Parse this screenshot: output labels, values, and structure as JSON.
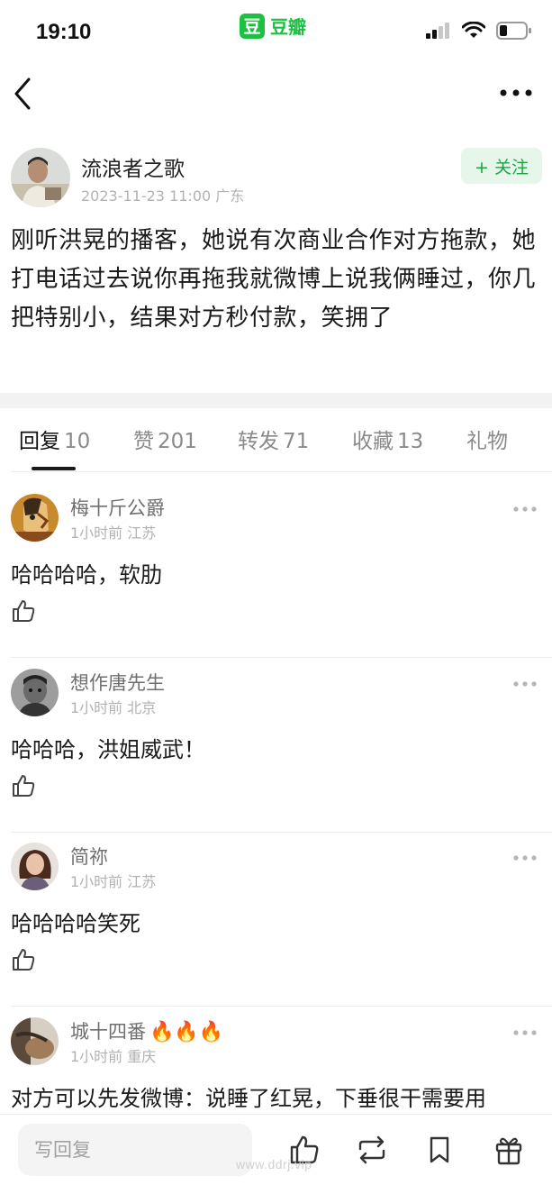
{
  "status_bar": {
    "time": "19:10",
    "app_logo_char": "豆",
    "app_name": "豆瓣"
  },
  "post": {
    "author": "流浪者之歌",
    "meta": "2023-11-23 11:00 广东",
    "follow_label": "+ 关注",
    "body": "刚听洪晃的播客，她说有次商业合作对方拖款，她打电话过去说你再拖我就微博上说我俩睡过，你几把特别小，结果对方秒付款，笑拥了"
  },
  "tabs": [
    {
      "label": "回复",
      "count": "10",
      "active": true
    },
    {
      "label": "赞",
      "count": "201",
      "active": false
    },
    {
      "label": "转发",
      "count": "71",
      "active": false
    },
    {
      "label": "收藏",
      "count": "13",
      "active": false
    },
    {
      "label": "礼物",
      "count": "",
      "active": false
    }
  ],
  "comments": [
    {
      "name": "梅十斤公爵",
      "meta": "1小时前 江苏",
      "text": "哈哈哈哈，软肋"
    },
    {
      "name": "想作唐先生",
      "meta": "1小时前 北京",
      "text": "哈哈哈，洪姐威武！"
    },
    {
      "name": "简祢",
      "meta": "1小时前 江苏",
      "text": "哈哈哈哈笑死"
    },
    {
      "name": "城十四番",
      "meta": "1小时前 重庆",
      "text": "对方可以先发微博：说睡了红晃，下垂很干需要用",
      "emoji": "🔥🔥🔥"
    }
  ],
  "bottom_bar": {
    "reply_placeholder": "写回复"
  },
  "watermark": "www.ddrj.vip",
  "colors": {
    "brand_green": "#1ec043",
    "follow_bg": "#e6f6ea",
    "follow_text": "#1ea441",
    "meta_gray": "#b2b2b2"
  }
}
